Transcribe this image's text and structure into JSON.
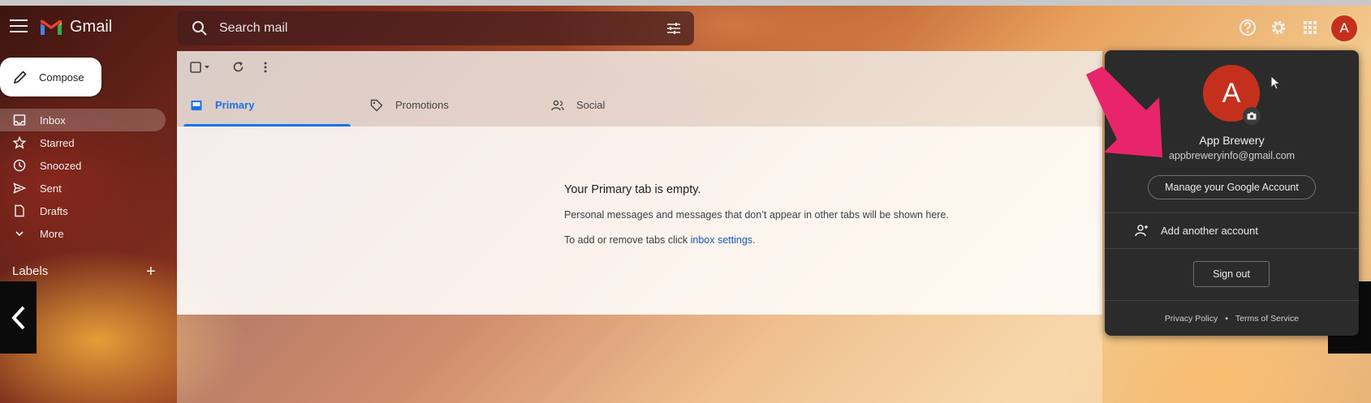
{
  "header": {
    "app_name": "Gmail",
    "search_placeholder": "Search mail",
    "avatar_letter": "A"
  },
  "sidebar": {
    "compose_label": "Compose",
    "items": [
      {
        "label": "Inbox",
        "icon": "inbox-icon",
        "active": true
      },
      {
        "label": "Starred",
        "icon": "star-icon"
      },
      {
        "label": "Snoozed",
        "icon": "clock-icon"
      },
      {
        "label": "Sent",
        "icon": "send-icon"
      },
      {
        "label": "Drafts",
        "icon": "draft-icon"
      },
      {
        "label": "More",
        "icon": "chevron-down-icon"
      }
    ],
    "labels_heading": "Labels",
    "labels_add": "+"
  },
  "main": {
    "tabs": [
      {
        "label": "Primary",
        "icon": "inbox-icon",
        "active": true
      },
      {
        "label": "Promotions",
        "icon": "tag-icon"
      },
      {
        "label": "Social",
        "icon": "people-icon"
      }
    ],
    "empty_title": "Your Primary tab is empty.",
    "empty_desc": "Personal messages and messages that don’t appear in other tabs will be shown here.",
    "settings_prefix": "To add or remove tabs click ",
    "settings_link": "inbox settings",
    "settings_suffix": "."
  },
  "account_popup": {
    "avatar_letter": "A",
    "name": "App Brewery",
    "email": "appbreweryinfo@gmail.com",
    "manage_label": "Manage your Google Account",
    "add_account_label": "Add another account",
    "sign_out_label": "Sign out",
    "privacy_label": "Privacy Policy",
    "separator": "•",
    "terms_label": "Terms of Service"
  },
  "colors": {
    "accent": "#1a73e8",
    "avatar": "#c5301c",
    "annotation_arrow": "#e8256a"
  }
}
